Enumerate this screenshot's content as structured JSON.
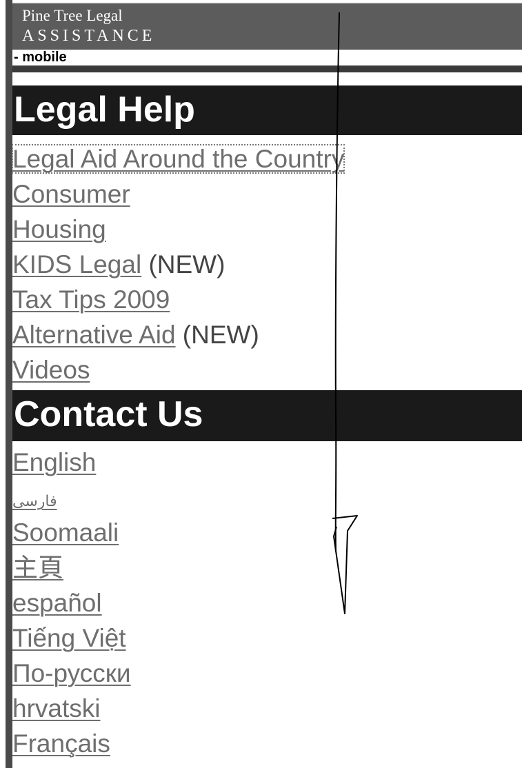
{
  "header": {
    "brand_line1": "Pine Tree Legal",
    "brand_line2": "ASSISTANCE",
    "mobile_label": "- mobile"
  },
  "legal_help": {
    "title": "Legal Help",
    "links": [
      {
        "label": "Legal Aid Around the Country",
        "note": ""
      },
      {
        "label": "Consumer",
        "note": ""
      },
      {
        "label": "Housing",
        "note": ""
      },
      {
        "label": "KIDS Legal",
        "note": " (NEW)"
      },
      {
        "label": "Tax Tips 2009",
        "note": ""
      },
      {
        "label": "Alternative Aid",
        "note": " (NEW)"
      },
      {
        "label": "Videos",
        "note": ""
      }
    ]
  },
  "contact_us": {
    "title": "Contact Us",
    "links": [
      {
        "label": "English"
      },
      {
        "label": "فارسی"
      },
      {
        "label": "Soomaali"
      },
      {
        "label": "主頁"
      },
      {
        "label": "español"
      },
      {
        "label": "Tiếng Việt"
      },
      {
        "label": "По-русски"
      },
      {
        "label": "hrvatski"
      },
      {
        "label": "Français"
      }
    ]
  },
  "colors": {
    "header_bg": "#5c5c5c",
    "section_bg": "#1a1a1a",
    "link": "#6e6e6e"
  },
  "annotation": {
    "icon": "scroll-down-arrow-icon"
  }
}
